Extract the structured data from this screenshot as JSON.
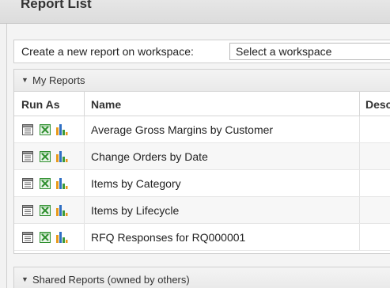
{
  "page": {
    "title": "Report List"
  },
  "create": {
    "label": "Create a new report on workspace:",
    "select_value": "Select a workspace"
  },
  "my_reports": {
    "title": "My Reports",
    "columns": {
      "run_as": "Run As",
      "name": "Name",
      "description": "Descr"
    },
    "rows": [
      {
        "name": "Average Gross Margins by Customer"
      },
      {
        "name": "Change Orders by Date"
      },
      {
        "name": "Items by Category"
      },
      {
        "name": "Items by Lifecycle"
      },
      {
        "name": "RFQ Responses for RQ000001"
      }
    ]
  },
  "shared_reports": {
    "title": "Shared Reports (owned by others)"
  },
  "icons": {
    "collapse": "caret-down-icon",
    "run_table": "table-report-icon",
    "run_excel": "excel-export-icon",
    "run_chart": "bar-chart-icon"
  },
  "colors": {
    "excel_green": "#2f8f2f",
    "chart_blue": "#2f6fc4",
    "chart_orange": "#e89a1a",
    "chart_green": "#3a9a3a"
  }
}
